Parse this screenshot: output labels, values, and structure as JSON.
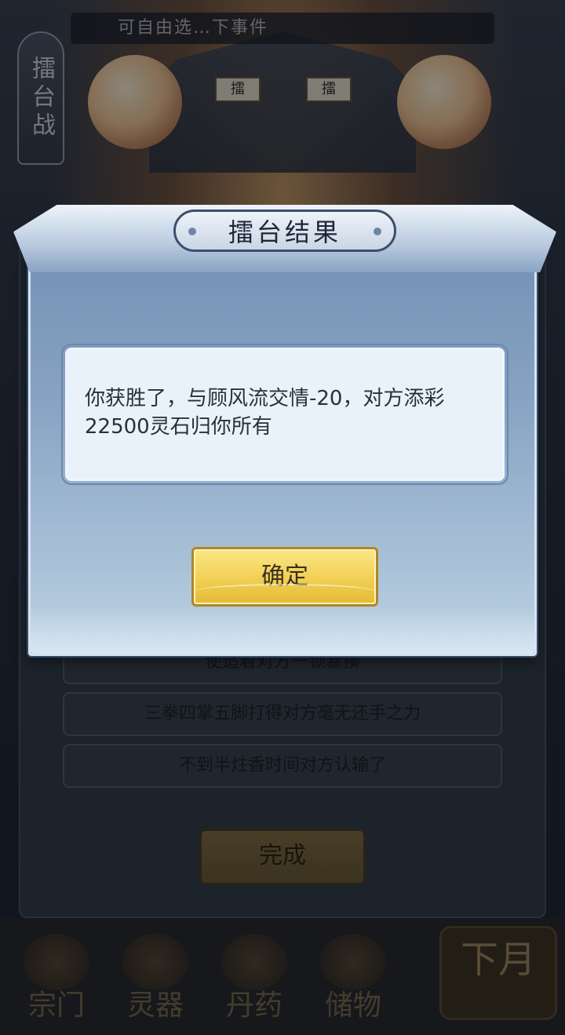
{
  "background": {
    "side_tag": "擂台战",
    "top_strip_text": "可自由选…下事件",
    "banner_char": "擂",
    "choices": [
      "使追着对方一顿暴揍",
      "三拳四掌五脚打得对方毫无还手之力",
      "不到半炷香时间对方认输了"
    ],
    "done_button": "完成"
  },
  "bottom_nav": {
    "items": [
      {
        "label": "宗门",
        "icon": "sect-icon"
      },
      {
        "label": "灵器",
        "icon": "artifact-icon"
      },
      {
        "label": "丹药",
        "icon": "pill-icon"
      },
      {
        "label": "储物",
        "icon": "storage-icon"
      }
    ],
    "next_month": "下月"
  },
  "dialog": {
    "title": "擂台结果",
    "message": "你获胜了，与顾风流交情-20，对方添彩22500灵石归你所有",
    "confirm_label": "确定"
  }
}
